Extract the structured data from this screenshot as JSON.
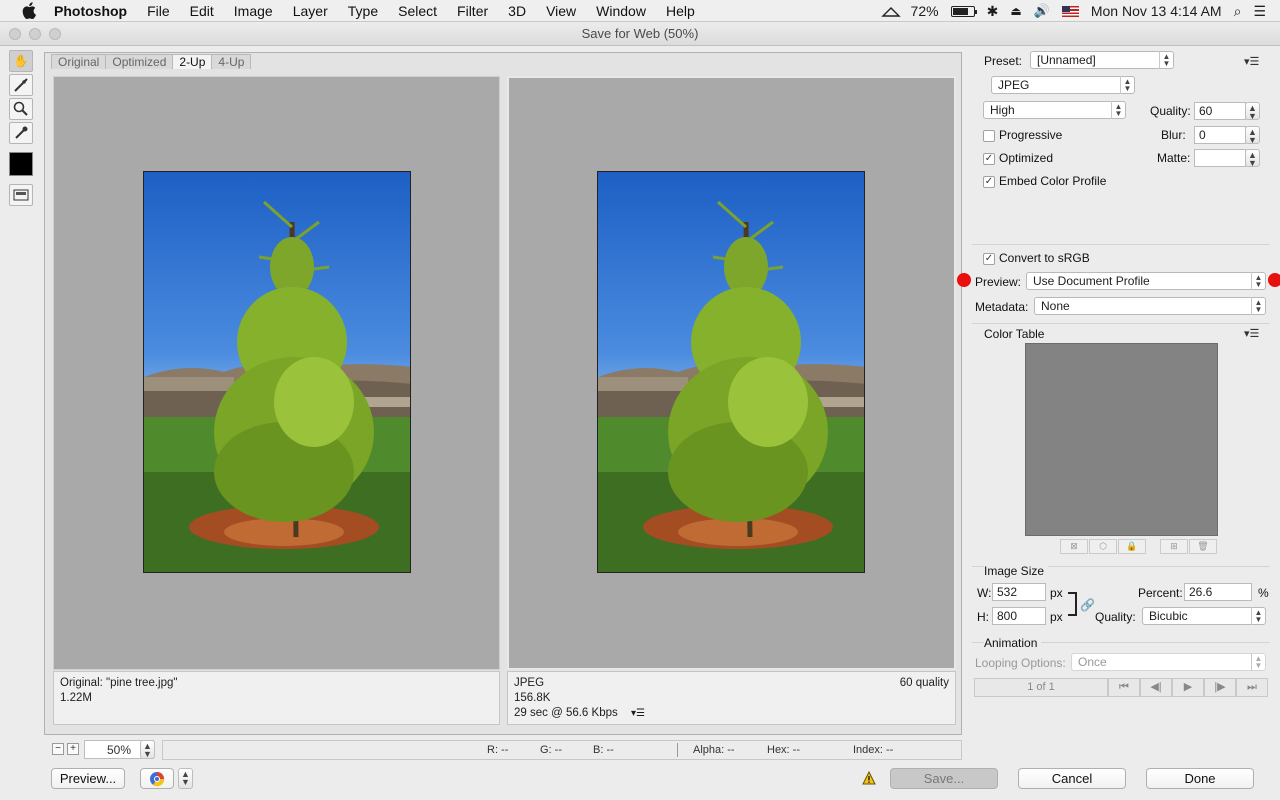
{
  "menubar": {
    "app": "Photoshop",
    "items": [
      "File",
      "Edit",
      "Image",
      "Layer",
      "Type",
      "Select",
      "Filter",
      "3D",
      "View",
      "Window",
      "Help"
    ],
    "battery": "72%",
    "clock": "Mon Nov 13  4:14 AM"
  },
  "window": {
    "title": "Save for Web (50%)"
  },
  "tabs": [
    "Original",
    "Optimized",
    "2-Up",
    "4-Up"
  ],
  "active_tab": "2-Up",
  "left_pane": {
    "line1": "Original: \"pine tree.jpg\"",
    "line2": "1.22M"
  },
  "right_pane": {
    "format": "JPEG",
    "size": "156.8K",
    "time": "29 sec @ 56.6 Kbps",
    "quality_label": "60 quality"
  },
  "status": {
    "zoom": "50%",
    "r": "R: --",
    "g": "G: --",
    "b": "B: --",
    "alpha": "Alpha: --",
    "hex": "Hex: --",
    "index": "Index: --"
  },
  "buttons": {
    "preview": "Preview...",
    "save": "Save...",
    "cancel": "Cancel",
    "done": "Done"
  },
  "settings": {
    "preset_label": "Preset:",
    "preset_value": "[Unnamed]",
    "format": "JPEG",
    "compression": "High",
    "quality_label": "Quality:",
    "quality_value": "60",
    "blur_label": "Blur:",
    "blur_value": "0",
    "matte_label": "Matte:",
    "progressive": "Progressive",
    "optimized": "Optimized",
    "embed_profile": "Embed Color Profile",
    "convert_srgb": "Convert to sRGB",
    "preview_label": "Preview:",
    "preview_value": "Use Document Profile",
    "metadata_label": "Metadata:",
    "metadata_value": "None",
    "color_table": "Color Table"
  },
  "image_size": {
    "title": "Image Size",
    "w_label": "W:",
    "w_value": "532",
    "w_unit": "px",
    "h_label": "H:",
    "h_value": "800",
    "h_unit": "px",
    "percent_label": "Percent:",
    "percent_value": "26.6",
    "percent_unit": "%",
    "quality_label": "Quality:",
    "quality_value": "Bicubic"
  },
  "animation": {
    "title": "Animation",
    "looping_label": "Looping Options:",
    "looping_value": "Once",
    "frame": "1 of 1"
  }
}
